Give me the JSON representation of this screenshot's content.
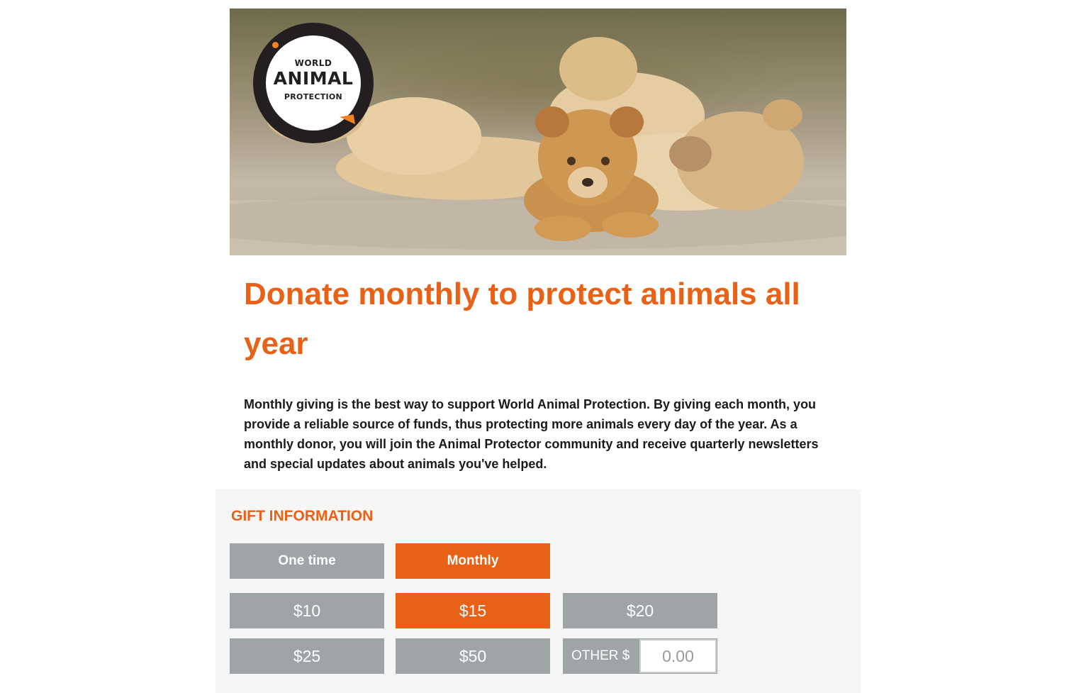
{
  "logo": {
    "line1": "WORLD",
    "line2": "ANIMAL",
    "line3": "PROTECTION"
  },
  "headline": "Donate monthly to protect animals all year",
  "intro": "Monthly giving is the best way to support World Animal Protection. By giving each month, you provide a reliable source of funds, thus protecting more animals every day of the year. As a monthly donor, you will join the Animal Protector community and receive quarterly newsletters and special updates about animals you've helped.",
  "gift": {
    "title": "GIFT INFORMATION",
    "frequency": {
      "one_time": "One time",
      "monthly": "Monthly",
      "selected": "Monthly"
    },
    "amounts": {
      "a10": "$10",
      "a15": "$15",
      "a20": "$20",
      "a25": "$25",
      "a50": "$50",
      "selected": "$15"
    },
    "other_label": "OTHER $",
    "other_placeholder": "0.00"
  },
  "colors": {
    "accent": "#e86116",
    "button_grey": "#9fa5a6",
    "panel_bg": "#f6f6f6",
    "logo_dark": "#231f20",
    "logo_orange": "#f58220"
  }
}
